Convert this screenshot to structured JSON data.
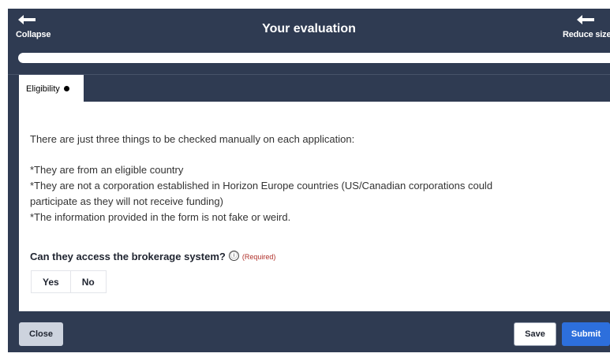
{
  "header": {
    "collapse_label": "Collapse",
    "title": "Your evaluation",
    "reduce_label": "Reduce size"
  },
  "progress": {
    "value_percent": 0
  },
  "tabs": [
    {
      "label": "Eligibility",
      "indicator": "dot-icon",
      "active": true
    }
  ],
  "content": {
    "intro": "There are just three things to be checked manually on each application:",
    "criteria": [
      "*They are from an eligible country",
      "*They are not a corporation established in Horizon Europe countries (US/Canadian corporations could",
      "participate as they will not receive funding)",
      "*The information provided in the form is not fake or weird."
    ],
    "question": {
      "label": "Can they access the brokerage system?",
      "info_icon": "ⓘ",
      "required_label": "(Required)",
      "options": [
        "Yes",
        "No"
      ]
    }
  },
  "footer": {
    "close_label": "Close",
    "save_label": "Save",
    "submit_label": "Submit"
  },
  "colors": {
    "panel_bg": "#2f3b52",
    "submit_bg": "#2d6fdc",
    "required": "#b0302a"
  }
}
